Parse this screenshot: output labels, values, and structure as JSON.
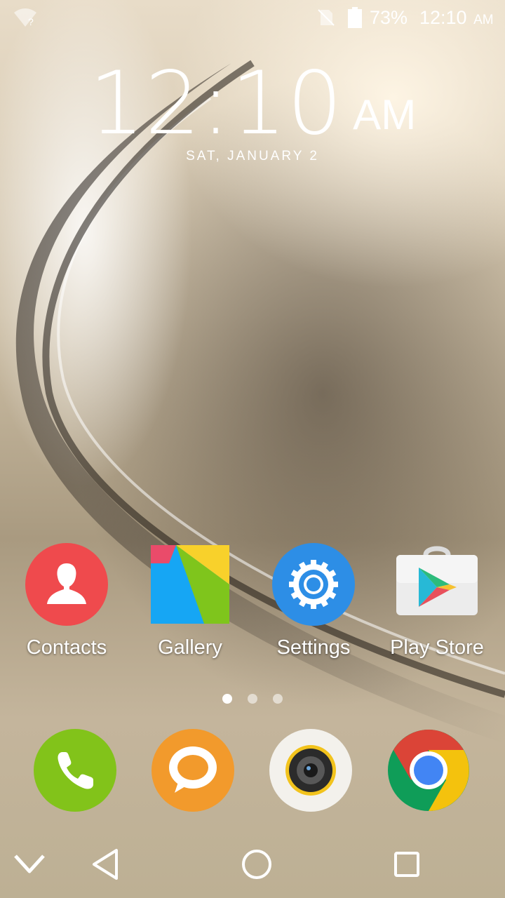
{
  "status_bar": {
    "battery": "73%",
    "time": "12:10",
    "ampm": "AM"
  },
  "clock": {
    "time": "12:10",
    "ampm": "AM",
    "date": "SAT, JANUARY 2"
  },
  "home_apps": [
    {
      "label": "Contacts",
      "icon": "contacts-icon"
    },
    {
      "label": "Gallery",
      "icon": "gallery-icon"
    },
    {
      "label": "Settings",
      "icon": "settings-icon"
    },
    {
      "label": "Play Store",
      "icon": "play-store-icon"
    }
  ],
  "page_indicator": {
    "pages": 3,
    "active": 0
  },
  "dock": [
    "phone-icon",
    "messaging-icon",
    "camera-icon",
    "chrome-icon"
  ],
  "navbar": [
    "collapse-icon",
    "back-icon",
    "home-icon",
    "recents-icon"
  ],
  "colors": {
    "contacts": "#ef4a4d",
    "settings": "#2d8ee6",
    "phone": "#82c31a",
    "messaging": "#f29a2c",
    "chrome_red": "#db4437",
    "chrome_yellow": "#f4c20d",
    "chrome_green": "#0f9d58",
    "chrome_blue": "#4285f4"
  }
}
